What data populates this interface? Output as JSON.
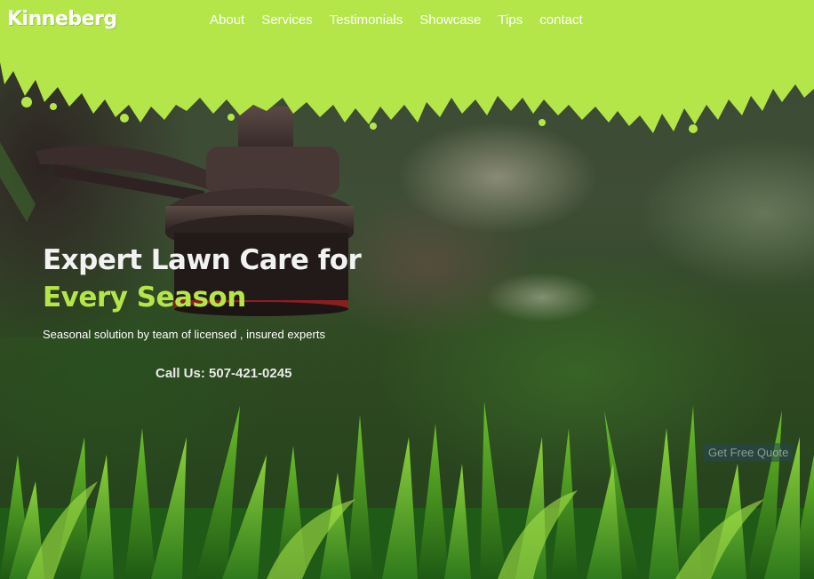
{
  "brand": {
    "logo": "Kinneberg",
    "accent_color": "#b4e64a"
  },
  "nav": {
    "items": [
      {
        "label": "About"
      },
      {
        "label": "Services"
      },
      {
        "label": "Testimonials"
      },
      {
        "label": "Showcase"
      },
      {
        "label": "Tips"
      },
      {
        "label": "contact"
      }
    ]
  },
  "hero": {
    "title_line1": "Expert Lawn Care for",
    "title_line2": "Every Season",
    "subtitle": "Seasonal solution by team of licensed , insured experts",
    "call_us": "Call Us: 507-421-0245",
    "cta_label": "Get Free Quote"
  }
}
